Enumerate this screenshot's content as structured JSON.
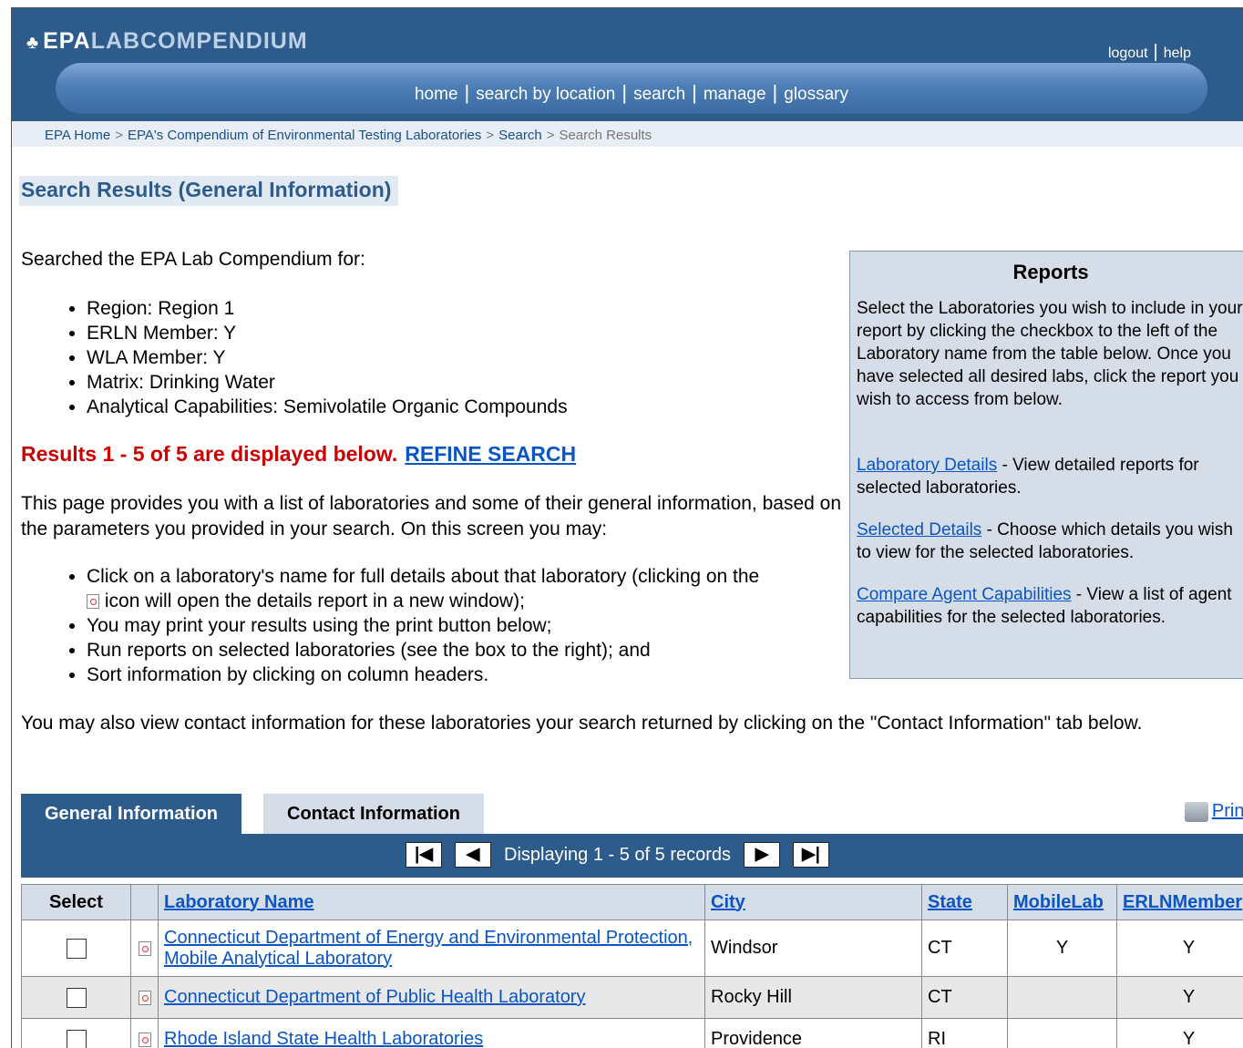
{
  "header": {
    "logo_bold": "EPA",
    "logo_rest": "LABCOMPENDIUM",
    "logout": "logout",
    "help": "help",
    "nav": [
      "home",
      "search by location",
      "search",
      "manage",
      "glossary"
    ]
  },
  "breadcrumb": [
    "EPA Home",
    "EPA's Compendium of Environmental Testing Laboratories",
    "Search",
    "Search Results"
  ],
  "page_title": "Search Results (General Information)",
  "searched_label": "Searched the EPA Lab Compendium for:",
  "criteria": [
    "Region: Region 1",
    "ERLN Member: Y",
    "WLA Member: Y",
    "Matrix: Drinking Water",
    "Analytical Capabilities: Semivolatile Organic Compounds"
  ],
  "results_text": "Results 1 - 5 of 5 are displayed below.",
  "refine_link": "REFINE SEARCH",
  "intro": "This page provides you with a list of laboratories and some of their general information, based on the parameters you provided in your search. On this screen you may:",
  "options": {
    "o1a": "Click on a laboratory's name for full details about that laboratory (clicking on the",
    "o1b": "icon will open the details report in a new window);",
    "o2": "You may print your results using the print button below;",
    "o3": "Run reports on selected laboratories (see the box to the right); and",
    "o4": "Sort information by clicking on column headers."
  },
  "contact_note": "You may also view contact information for these laboratories your search returned by clicking on the \"Contact Information\" tab below.",
  "reports": {
    "title": "Reports",
    "intro": "Select the Laboratories you wish to include in your report by clicking the checkbox to the left of the Laboratory name from the table below. Once you have selected all desired labs, click the report you wish to access from below.",
    "r1_link": "Laboratory Details",
    "r1_text": " - View detailed reports for selected laboratories.",
    "r2_link": "Selected Details",
    "r2_text": " - Choose which details you wish to view for the selected laboratories.",
    "r3_link": "Compare Agent Capabilities",
    "r3_text": " - View a list of agent capabilities for the selected laboratories."
  },
  "tabs": {
    "general": "General Information",
    "contact": "Contact Information",
    "print": "Print"
  },
  "pager": {
    "first": "|◀",
    "prev": "◀",
    "next": "▶",
    "last": "▶|",
    "display": "Displaying 1 - 5 of 5 records"
  },
  "table": {
    "headers": {
      "select": "Select",
      "name": "Laboratory Name",
      "city": "City",
      "state": "State",
      "mobile": "MobileLab",
      "erln": "ERLNMember"
    },
    "rows": [
      {
        "name": "Connecticut Department of Energy and Environmental Protection, Mobile Analytical Laboratory",
        "city": "Windsor",
        "state": "CT",
        "mobile": "Y",
        "erln": "Y"
      },
      {
        "name": "Connecticut Department of Public Health Laboratory",
        "city": "Rocky Hill",
        "state": "CT",
        "mobile": "",
        "erln": "Y"
      },
      {
        "name": "Rhode Island State Health Laboratories",
        "city": "Providence",
        "state": "RI",
        "mobile": "",
        "erln": "Y"
      }
    ]
  }
}
